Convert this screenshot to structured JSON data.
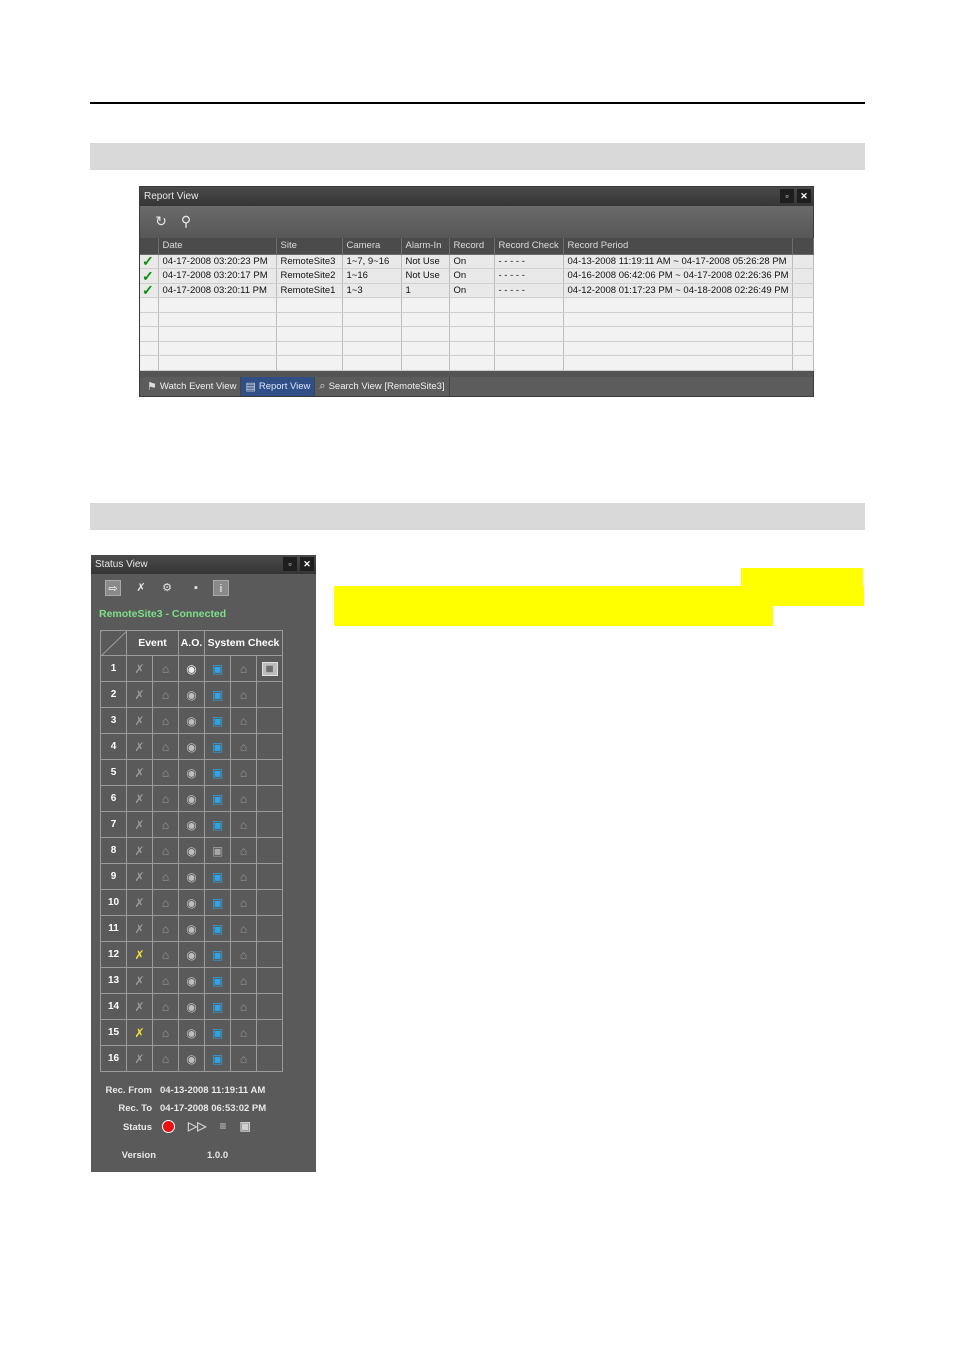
{
  "report_view": {
    "title": "Report View",
    "toolbar": {
      "refresh_icon": "refresh-icon",
      "filter_icon": "search-user-icon"
    },
    "columns": [
      "Date",
      "Site",
      "Camera",
      "Alarm-In",
      "Record",
      "Record Check",
      "Record Period"
    ],
    "rows": [
      {
        "check": "✓",
        "date": "04-17-2008  03:20:23 PM",
        "site": "RemoteSite3",
        "camera": "1~7, 9~16",
        "alarm_in": "Not Use",
        "record": "On",
        "record_check": "- - - - -",
        "period": "04-13-2008  11:19:11 AM ~ 04-17-2008  05:26:28 PM"
      },
      {
        "check": "✓",
        "date": "04-17-2008  03:20:17 PM",
        "site": "RemoteSite2",
        "camera": "1~16",
        "alarm_in": "Not Use",
        "record": "On",
        "record_check": "- - - - -",
        "period": "04-16-2008  06:42:06 PM ~ 04-17-2008  02:26:36 PM"
      },
      {
        "check": "✓",
        "date": "04-17-2008  03:20:11 PM",
        "site": "RemoteSite1",
        "camera": "1~3",
        "alarm_in": "1",
        "record": "On",
        "record_check": "- - - - -",
        "period": "04-12-2008  01:17:23 PM ~ 04-18-2008  02:26:49 PM"
      }
    ],
    "tabs": [
      {
        "label": "Watch Event View",
        "active": false
      },
      {
        "label": "Report View",
        "active": true
      },
      {
        "label": "Search View [RemoteSite3]",
        "active": false
      }
    ]
  },
  "status_view": {
    "title": "Status View",
    "connection": "RemoteSite3 - Connected",
    "headers": {
      "event": "Event",
      "ao": "A.O.",
      "system_check": "System Check"
    },
    "channels": [
      {
        "n": "1",
        "motion": false,
        "ao": true,
        "cam": true
      },
      {
        "n": "2",
        "motion": false,
        "ao": false,
        "cam": true
      },
      {
        "n": "3",
        "motion": false,
        "ao": false,
        "cam": true
      },
      {
        "n": "4",
        "motion": false,
        "ao": false,
        "cam": true
      },
      {
        "n": "5",
        "motion": false,
        "ao": false,
        "cam": true
      },
      {
        "n": "6",
        "motion": false,
        "ao": false,
        "cam": true
      },
      {
        "n": "7",
        "motion": false,
        "ao": false,
        "cam": true
      },
      {
        "n": "8",
        "motion": false,
        "ao": false,
        "cam": false
      },
      {
        "n": "9",
        "motion": false,
        "ao": false,
        "cam": true
      },
      {
        "n": "10",
        "motion": false,
        "ao": false,
        "cam": true
      },
      {
        "n": "11",
        "motion": false,
        "ao": false,
        "cam": true
      },
      {
        "n": "12",
        "motion": true,
        "ao": false,
        "cam": true
      },
      {
        "n": "13",
        "motion": false,
        "ao": false,
        "cam": true
      },
      {
        "n": "14",
        "motion": false,
        "ao": false,
        "cam": true
      },
      {
        "n": "15",
        "motion": true,
        "ao": false,
        "cam": true
      },
      {
        "n": "16",
        "motion": false,
        "ao": false,
        "cam": true
      }
    ],
    "rec_from_label": "Rec. From",
    "rec_from": "04-13-2008 11:19:11 AM",
    "rec_to_label": "Rec. To",
    "rec_to": "04-17-2008 06:53:02 PM",
    "status_label": "Status",
    "version_label": "Version",
    "version": "1.0.0"
  },
  "colors": {
    "highlight": "#ffff00",
    "connected": "#7ee08a",
    "motion_active": "#f3e53a",
    "camera_ok": "#2fa3e3",
    "recording": "#e81010"
  }
}
